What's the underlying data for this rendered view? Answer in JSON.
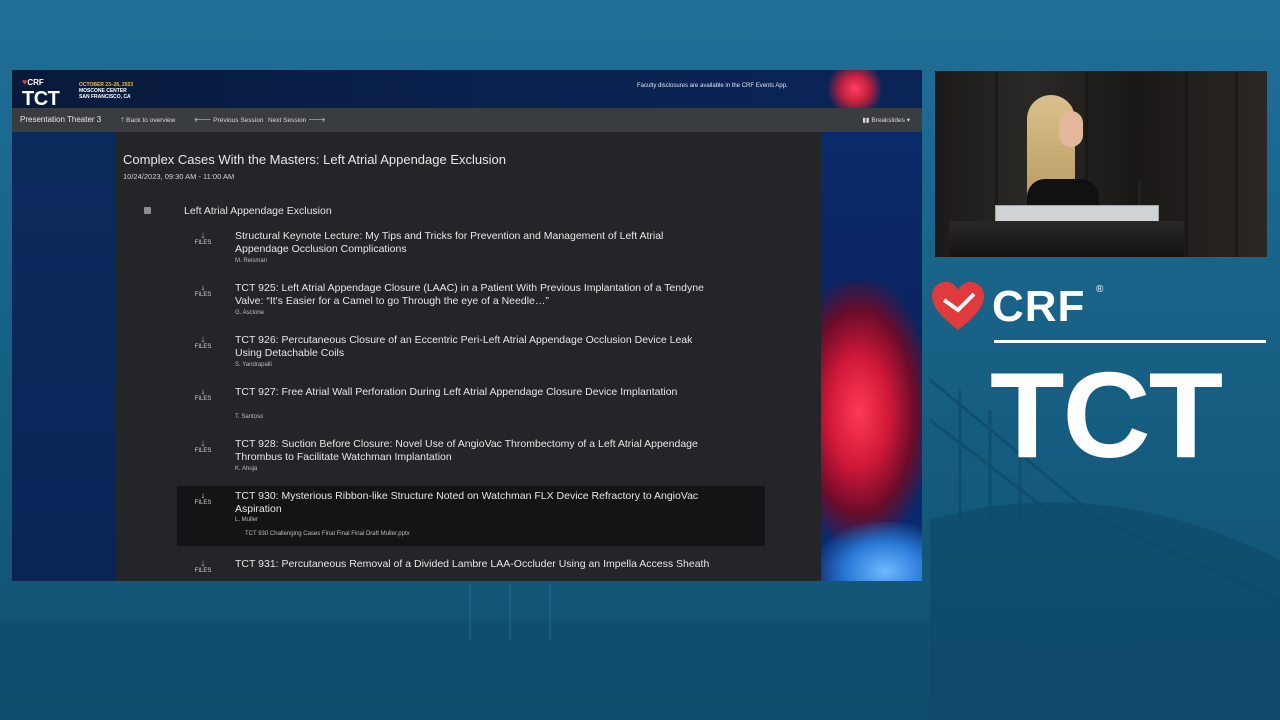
{
  "banner": {
    "org": "CRF",
    "event": "TCT",
    "dates": "OCTOBER 23–26, 2023",
    "venue": "MOSCONE CENTER",
    "city": "SAN FRANCISCO, CA",
    "disclosure": "Faculty disclosures are available in the CRF Events App."
  },
  "nav": {
    "title": "Presentation Theater 3",
    "back": "🡑 Back to overview",
    "previous": "🡐 Previous Session",
    "next": "Next Session 🡒",
    "breakslides": "▮▮ Breakslides ▾"
  },
  "session": {
    "title": "Complex Cases With the Masters: Left Atrial Appendage Exclusion",
    "time": "10/24/2023, 09:30 AM - 11:00 AM",
    "section": "Left Atrial Appendage Exclusion"
  },
  "files_label": "FILES",
  "talks": [
    {
      "title": "Structural Keynote Lecture: My Tips and Tricks for Prevention and Management of Left Atrial Appendage Occlusion Complications",
      "author": "M. Reisman"
    },
    {
      "title": "TCT 925: Left Atrial Appendage Closure (LAAC) in a Patient With Previous Implantation of a Tendyne Valve: “It's Easier for a Camel to go Through the eye of a Needle…”",
      "author": "G. Ascione"
    },
    {
      "title": "TCT 926: Percutaneous Closure of an Eccentric Peri-Left Atrial Appendage Occlusion Device Leak Using Detachable Coils",
      "author": "S. Yandrapalli"
    },
    {
      "title": "TCT 927: Free Atrial Wall Perforation During Left Atrial Appendage Closure Device Implantation",
      "author": "T. Santoso"
    },
    {
      "title": "TCT 928: Suction Before Closure: Novel Use of AngioVac Thrombectomy of a Left Atrial Appendage Thrombus to Facilitate Watchman Implantation",
      "author": "K. Ahuja"
    },
    {
      "title": "TCT 930: Mysterious Ribbon-like Structure Noted on Watchman FLX Device Refractory to AngioVac Aspiration",
      "author": "L. Muller",
      "file": "TCT 930 Challenging Cases Final Final Final Draft Muller.pptx"
    },
    {
      "title": "TCT 931: Percutaneous Removal of a Divided Lambre LAA-Occluder Using an Impella Access Sheath",
      "author": ""
    }
  ],
  "branding": {
    "crf": "CRF",
    "registered": "®",
    "tct": "TCT"
  },
  "colors": {
    "background": "#176286",
    "brand_red": "#e23a3a",
    "content_panel": "#232528",
    "navbar": "#3a3d40"
  }
}
